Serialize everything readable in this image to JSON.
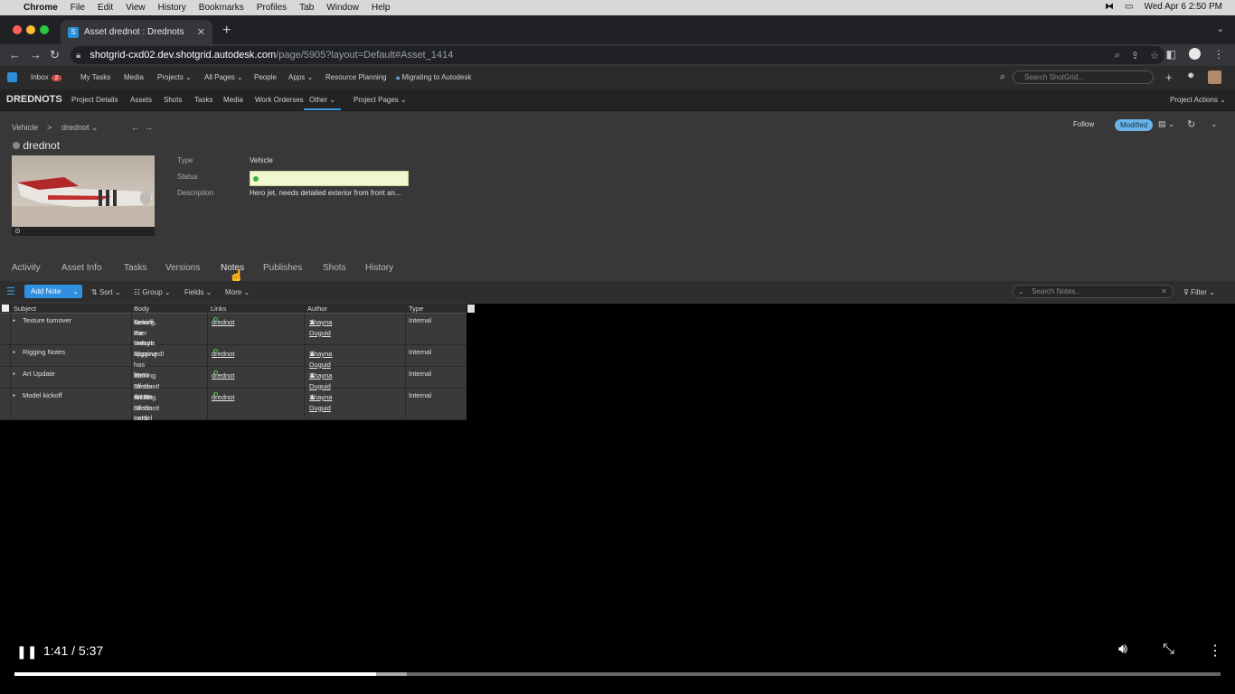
{
  "mac_menu": {
    "app": "Chrome",
    "items": [
      "File",
      "Edit",
      "View",
      "History",
      "Bookmarks",
      "Profiles",
      "Tab",
      "Window",
      "Help"
    ],
    "clock": "Wed Apr 6  2:50 PM"
  },
  "browser": {
    "tab_title": "Asset drednot : Drednots",
    "url_host": "shotgrid-cxd02.dev.shotgrid.autodesk.com",
    "url_path": "/page/5905?layout=Default#Asset_1414"
  },
  "global_nav": {
    "inbox_label": "Inbox",
    "inbox_count": "2",
    "my_tasks": "My Tasks",
    "media": "Media",
    "projects": "Projects",
    "all_pages": "All Pages",
    "people": "People",
    "apps": "Apps",
    "resource_planning": "Resource Planning",
    "migrating": "Migrating to Autodesk",
    "search_placeholder": "Search ShotGrid..."
  },
  "project_nav": {
    "project_name": "DREDNOTS",
    "items": [
      "Project Details",
      "Assets",
      "Shots",
      "Tasks",
      "Media",
      "Work Orderses",
      "Other",
      "Project Pages"
    ],
    "project_actions": "Project Actions"
  },
  "header": {
    "crumb_entity": "Vehicle",
    "crumb_sep": ">",
    "crumb_name": "drednot",
    "follow": "Follow",
    "modified": "Modified",
    "title": "drednot"
  },
  "fields": {
    "type_label": "Type",
    "type_value": "Vehicle",
    "status_label": "Status",
    "description_label": "Description",
    "description_value": "Hero jet, needs detailed exterior from front an..."
  },
  "detail_tabs": [
    "Activity",
    "Asset Info",
    "Tasks",
    "Versions",
    "Notes",
    "Publishes",
    "Shots",
    "History"
  ],
  "toolbar": {
    "add_note": "Add Note",
    "sort": "Sort",
    "group": "Group",
    "fields": "Fields",
    "more": "More",
    "search_placeholder": "Search Notes...",
    "filter": "Filter"
  },
  "notes_table": {
    "columns": [
      "Subject",
      "Body",
      "Links",
      "Author",
      "Type"
    ],
    "rows": [
      {
        "subject": "Texture turnover",
        "body": [
          "Dessie, It's time to",
          "kickoff the texture,",
          "turning over today!"
        ],
        "link": "drednot",
        "author": "Shayna Duguid",
        "type": "Internal"
      },
      {
        "subject": "Rigging Notes",
        "body": [
          "Rigging has been",
          "approved!"
        ],
        "link": "drednot",
        "author": "Shayna Duguid",
        "type": "Internal"
      },
      {
        "subject": "Art Update",
        "body": [
          "Kicking off the Art on",
          "the Drednot!"
        ],
        "link": "drednot",
        "author": "Shayna Duguid",
        "type": "Internal"
      },
      {
        "subject": "Model kickoff",
        "body": [
          "Kicking off the model",
          "on the Drednot! Let's",
          "rock!"
        ],
        "link": "drednot",
        "author": "Shayna Duguid",
        "type": "Internal"
      }
    ]
  },
  "video": {
    "time": "1:41 / 5:37",
    "progress_fraction": 0.3,
    "buffered_fraction": 0.325
  }
}
